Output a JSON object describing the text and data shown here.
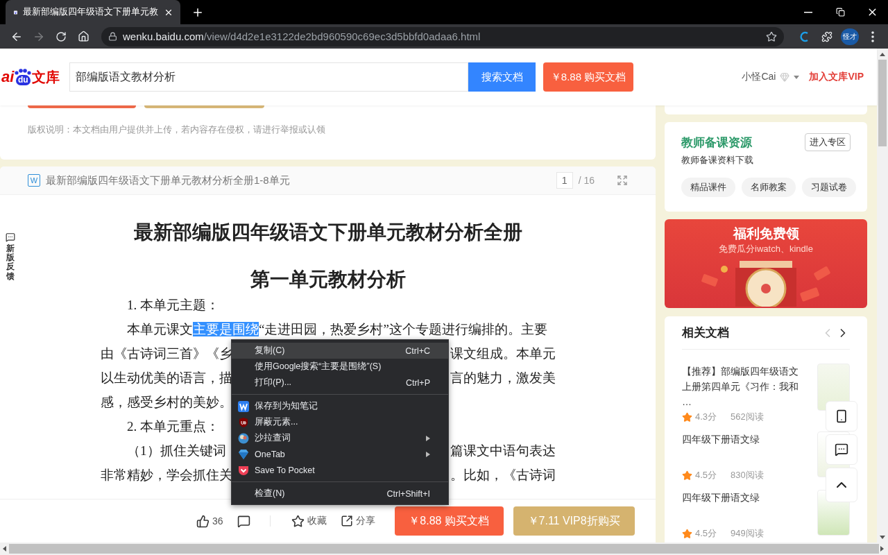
{
  "browser": {
    "tab": {
      "title": "最新部编版四年级语文下册单元教",
      "selected": true
    },
    "url": {
      "host": "wenku.baidu.com",
      "path": "/view/d4d2e1e3122de2bd960590c69ec3d5bbfd0adaa6.html"
    },
    "forward_disabled": true,
    "profile": "怪才"
  },
  "header": {
    "logo": {
      "latin": "ai",
      "paw": "du",
      "name": "文库"
    },
    "search": {
      "value": "部编版语文教材分析"
    },
    "search_button": "搜索文档",
    "buy_button": "￥8.88 购买文档",
    "user": "小怪Cai",
    "vip_link": "加入文库VIP"
  },
  "notice": "版权说明：本文档由用户提供并上传，若内容存在侵权，请进行举报或认领",
  "document": {
    "file_badge": "W",
    "header_title": "最新部编版四年级语文下册单元教材分析全册1-8单元",
    "page": "1",
    "pages": "/ 16",
    "title": "最新部编版四年级语文下册单元教材分析全册",
    "subtitle": "第一单元教材分析",
    "lines": [
      {
        "kind": "first",
        "parts": [
          {
            "text": "1. 本单元主题：",
            "selected": false
          }
        ]
      },
      {
        "kind": "first",
        "parts": [
          {
            "text": "本单元课文",
            "selected": false
          },
          {
            "text": "主要是围绕",
            "selected": true
          },
          {
            "text": "“走进田园，热爱乡村”这个专题进行编排的。主要",
            "selected": false
          }
        ]
      },
      {
        "kind": "cont",
        "parts": [
          {
            "text": "由《古诗词三首》《乡",
            "selected": false
          }
        ],
        "right": "课文组成。本单元"
      },
      {
        "kind": "cont",
        "parts": [
          {
            "text": "以生动优美的语言，描",
            "selected": false
          }
        ],
        "right": "言的魅力，激发美"
      },
      {
        "kind": "cont",
        "parts": [
          {
            "text": "感，感受乡村的美妙。",
            "selected": false
          }
        ]
      },
      {
        "kind": "first",
        "parts": [
          {
            "text": "2. 本单元重点：",
            "selected": false
          }
        ]
      },
      {
        "kind": "first",
        "parts": [
          {
            "text": "（1）抓住关键词",
            "selected": false
          }
        ],
        "right": "篇课文中语句表达"
      },
      {
        "kind": "cont",
        "parts": [
          {
            "text": "非常精妙，学会抓住关",
            "selected": false
          }
        ],
        "right": "。比如，《古诗词"
      }
    ]
  },
  "feedback": "新版反馈",
  "actions": {
    "likes": "36",
    "favorite": "收藏",
    "share": "分享",
    "buy": "￥8.88 购买文档",
    "vip_buy": "￥7.11 VIP8折购买"
  },
  "teacher_card": {
    "title": "教师备课资源",
    "button": "进入专区",
    "subtitle": "教师备课资料下载",
    "chips": [
      "精品课件",
      "名师教案",
      "习题试卷"
    ]
  },
  "promo": {
    "title": "福利免费领",
    "subtitle": "免费瓜分iwatch、kindle"
  },
  "related": {
    "title": "相关文档",
    "prev_disabled": true,
    "items": [
      {
        "title": "【推荐】部编版四年级语文上册第四单元《习作：我和 …",
        "score": "4.3分",
        "reads": "562阅读"
      },
      {
        "title": "四年级下册语文绿",
        "score": "4.5分",
        "reads": "830阅读"
      },
      {
        "title": "四年级下册语文绿",
        "score": "4.5分",
        "reads": "949阅读"
      }
    ]
  },
  "context_menu": {
    "items": [
      {
        "kind": "command",
        "label": "复制(C)",
        "shortcut": "Ctrl+C",
        "highlighted": true,
        "submenu": false
      },
      {
        "kind": "command",
        "label": "使用Google搜索“主要是围绕”(S)",
        "highlighted": false,
        "submenu": false
      },
      {
        "kind": "command",
        "label": "打印(P)...",
        "shortcut": "Ctrl+P",
        "highlighted": false,
        "submenu": false
      },
      {
        "kind": "separator"
      },
      {
        "kind": "extension",
        "label": "保存到为知笔记",
        "highlighted": false,
        "submenu": false
      },
      {
        "kind": "extension",
        "label": "屏蔽元素...",
        "highlighted": false,
        "submenu": false
      },
      {
        "kind": "extension",
        "label": "沙拉查词",
        "highlighted": false,
        "submenu": true
      },
      {
        "kind": "extension",
        "label": "OneTab",
        "highlighted": false,
        "submenu": true
      },
      {
        "kind": "extension",
        "label": "Save To Pocket",
        "highlighted": false,
        "submenu": false
      },
      {
        "kind": "separator"
      },
      {
        "kind": "command",
        "label": "检查(N)",
        "shortcut": "Ctrl+Shift+I",
        "highlighted": false,
        "submenu": false
      }
    ]
  }
}
